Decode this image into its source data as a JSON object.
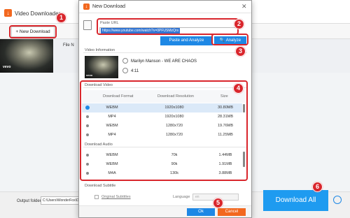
{
  "app": {
    "title": "Video Downloader",
    "new_download": "+ New Download",
    "file_label": "File N",
    "output_label": "Output folder:",
    "output_path": "C:\\Users\\WonderFox\\Desktop",
    "download_all": "Download All",
    "vevo": "vevo"
  },
  "dialog": {
    "title": "New Download",
    "close": "✕",
    "url_label": "Paste URL",
    "url_value": "https://www.youtube.com/watch?v=0PFUSMzQrs",
    "paste_analyze": "Paste and Analyze",
    "analyze": "Analyze",
    "video_info_header": "Video Information",
    "video_title": "Marilyn Manson - WE ARE CHAOS",
    "duration": "4:11",
    "vevo": "vevo",
    "download_video_header": "Download Video",
    "col_format": "Download Format",
    "col_resolution": "Download Resolution",
    "col_size": "Size",
    "video_rows": [
      {
        "format": "WEBM",
        "resolution": "1920x1080",
        "size": "30.80MB",
        "selected": true
      },
      {
        "format": "MP4",
        "resolution": "1920x1080",
        "size": "28.31MB",
        "selected": false
      },
      {
        "format": "WEBM",
        "resolution": "1280x720",
        "size": "19.76MB",
        "selected": false
      },
      {
        "format": "MP4",
        "resolution": "1280x720",
        "size": "11.25MB",
        "selected": false
      }
    ],
    "download_audio_header": "Download Audio",
    "audio_rows": [
      {
        "format": "WEBM",
        "bitrate": "70k",
        "size": "1.44MB"
      },
      {
        "format": "WEBM",
        "bitrate": "90k",
        "size": "1.91MB"
      },
      {
        "format": "M4A",
        "bitrate": "130k",
        "size": "3.88MB"
      }
    ],
    "download_subtitle_header": "Download Subtitle",
    "original_subtitles": "Original Subtitles",
    "language_label": "Language",
    "language_value": "en",
    "ok": "Ok",
    "cancel": "Cancel"
  },
  "badges": [
    "1",
    "2",
    "3",
    "4",
    "5",
    "6"
  ],
  "colors": {
    "accent": "#1e88e5",
    "highlight": "#d9262c",
    "cancel": "#f2681f"
  }
}
